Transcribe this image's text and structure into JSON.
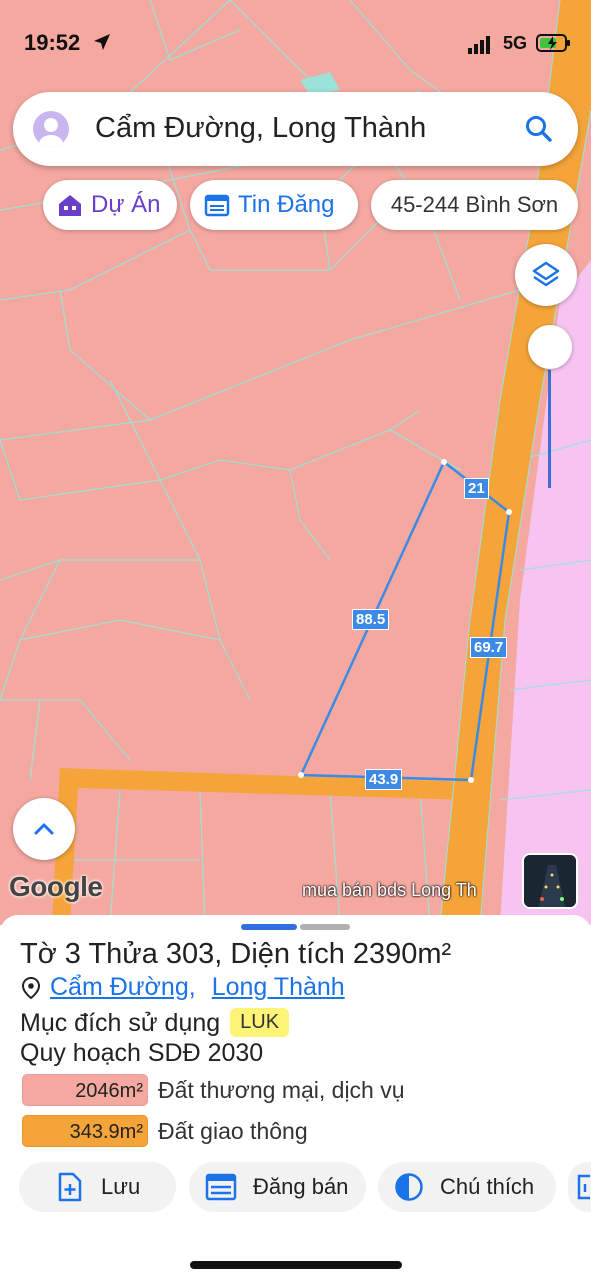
{
  "status_bar": {
    "time": "19:52",
    "network": "5G"
  },
  "search": {
    "query": "Cẩm Đường, Long Thành"
  },
  "chips": {
    "du_an": "Dự Án",
    "tin_dang": "Tin Đăng",
    "lot_code": "45-244 Bình Sơn"
  },
  "map": {
    "edge_labels": {
      "top": "21",
      "left": "88.5",
      "right": "69.7",
      "bottom": "43.9"
    },
    "google_logo": "Google",
    "watermark": "mua bán bds Long Th",
    "colors": {
      "commercial_land": "#f4a8a0",
      "road": "#f5a43a",
      "residential": "#f7c4f2",
      "parcel_outline": "#3b8ae6"
    }
  },
  "sheet": {
    "title": "Tờ 3 Thửa 303, Diện tích 2390m²",
    "commune": "Cẩm Đường",
    "district": "Long Thành",
    "purpose_label": "Mục đích sử dụng",
    "purpose_code": "LUK",
    "plan_label": "Quy hoạch SDĐ 2030",
    "legend": [
      {
        "area": "2046m²",
        "label": "Đất thương mại, dịch vụ",
        "color": "#f4a8a0"
      },
      {
        "area": "343.9m²",
        "label": "Đất giao thông",
        "color": "#f5a43a"
      }
    ],
    "actions": {
      "save": "Lưu",
      "post": "Đăng bán",
      "legend": "Chú thích"
    }
  }
}
